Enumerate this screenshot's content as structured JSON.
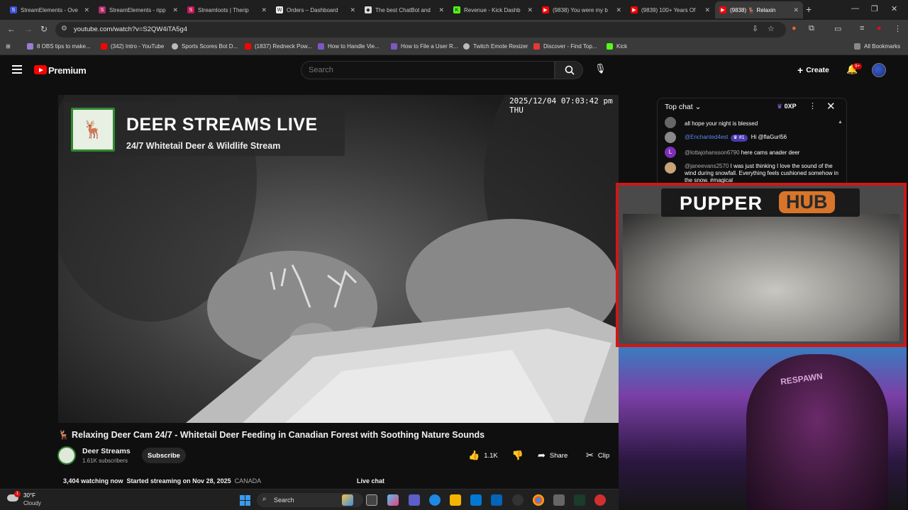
{
  "browser": {
    "tabs": [
      {
        "label": "StreamElements - Ove",
        "color": "#3f51d6"
      },
      {
        "label": "StreamElements - ripp",
        "color": "#b32b6a"
      },
      {
        "label": "Streamloots | Therip",
        "color": "#c2185b"
      },
      {
        "label": "Orders – Dashboard",
        "color": "#eeeeee"
      },
      {
        "label": "The best ChatBot and",
        "color": "#dddddd"
      },
      {
        "label": "Revenue - Kick Dashb",
        "color": "#53fc18"
      },
      {
        "label": "(9838) You were my b",
        "color": "#ff0000"
      },
      {
        "label": "(9839) 100+ Years Of",
        "color": "#ff0000"
      },
      {
        "label": "(9838) 🦌 Relaxin",
        "color": "#ff0000"
      }
    ],
    "url": "youtube.com/watch?v=S2QW4iTA5g4",
    "bookmarks": [
      {
        "label": "8 OBS tips to make...",
        "color": "#9c7bd1"
      },
      {
        "label": "(342) Intro - YouTube",
        "color": "#ff0000"
      },
      {
        "label": "Sports Scores Bot D...",
        "color": "#bbbbbb"
      },
      {
        "label": "(1837) Redneck Pow...",
        "color": "#ff0000"
      },
      {
        "label": "How to Handle Vie...",
        "color": "#7e57c2"
      },
      {
        "label": "How to File a User R...",
        "color": "#7e57c2"
      },
      {
        "label": "Twitch Emote Resizer",
        "color": "#bbbbbb"
      },
      {
        "label": "Discover - Find Top...",
        "color": "#e53935"
      },
      {
        "label": "Kick",
        "color": "#53fc18"
      }
    ],
    "all_bookmarks": "All Bookmarks"
  },
  "youtube": {
    "brand": "Premium",
    "search_placeholder": "Search",
    "create_label": "Create",
    "notif_count": "9+",
    "video": {
      "overlay_title": "DEER STREAMS LIVE",
      "overlay_subtitle": "24/7 Whitetail Deer & Wildlife Stream",
      "cam_timestamp": "2025/12/04 07:03:42 pm THU",
      "title": "🦌 Relaxing Deer Cam 24/7 - Whitetail Deer Feeding in Canadian Forest with Soothing Nature Sounds"
    },
    "channel": {
      "name": "Deer Streams",
      "subscribers": "1.61K subscribers",
      "subscribe_label": "Subscribe"
    },
    "actions": {
      "likes": "1.1K",
      "share": "Share",
      "clip": "Clip"
    },
    "meta": {
      "watching": "3,404 watching now",
      "started": "Started streaming on Nov 28, 2025",
      "country": "CANADA"
    },
    "live_chat_label": "Live chat"
  },
  "chat": {
    "header": "Top chat",
    "xp": "0XP",
    "messages": [
      {
        "author": "",
        "text": "all hope your night is blessed"
      },
      {
        "author": "@Enchanted4est",
        "badge": "#1",
        "text": "Hi @flaGurl56"
      },
      {
        "author": "@lottajohansson6790",
        "text": "here cams anader deer",
        "initial": "L"
      },
      {
        "author": "@janeevans2570",
        "text": "I was just thinking I love the sound of the wind during snowfall. Everything feels cushioned somehow in the snow. #magical"
      }
    ]
  },
  "overlay": {
    "word1": "PUPPER",
    "word2": "HUB",
    "chair_logo": "RESPAWN"
  },
  "taskbar": {
    "temp": "30°F",
    "weather": "Cloudy",
    "weather_badge": "1",
    "search": "Search"
  }
}
